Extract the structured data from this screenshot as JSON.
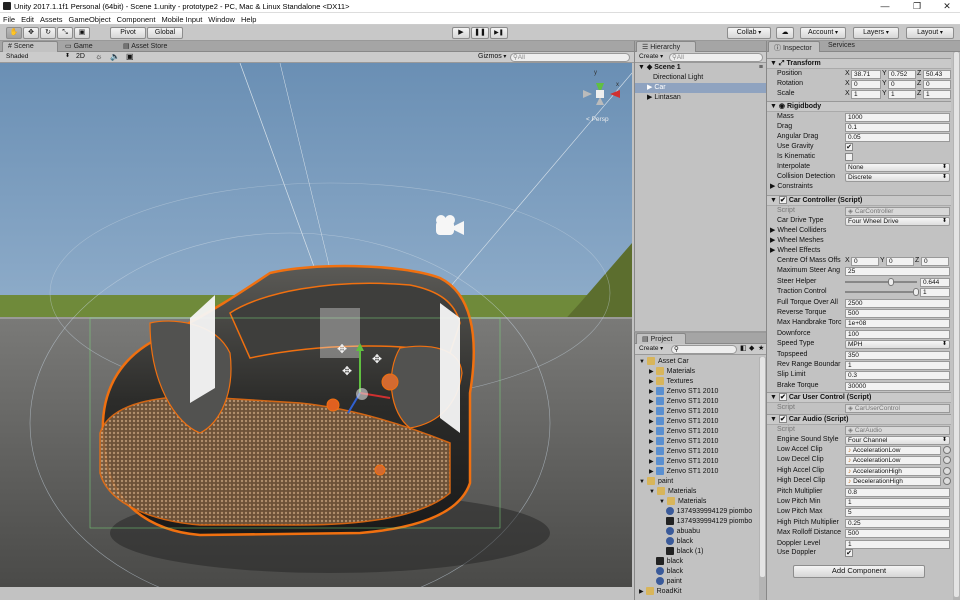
{
  "window": {
    "title": "Unity 2017.1.1f1 Personal (64bit) - Scene 1.unity - prototype2 - PC, Mac & Linux Standalone <DX11>",
    "min": "—",
    "max": "❐",
    "close": "✕"
  },
  "menu": [
    "File",
    "Edit",
    "Assets",
    "GameObject",
    "Component",
    "Mobile Input",
    "Window",
    "Help"
  ],
  "toolbar": {
    "pivot": "Pivot",
    "global": "Global",
    "collab": "Collab",
    "account": "Account",
    "layers": "Layers",
    "layout": "Layout",
    "play": "▶",
    "pause": "❚❚",
    "step": "▶❚"
  },
  "scene": {
    "tabs": [
      "Scene",
      "Game",
      "Asset Store"
    ],
    "shading": "Shaded",
    "mode2d": "2D",
    "gizmos": "Gizmos",
    "search": "All",
    "persp": "< Persp",
    "axes": {
      "y": "y",
      "x": "x"
    }
  },
  "hierarchy": {
    "tab": "Hierarchy",
    "create": "Create",
    "search": "All",
    "scene": "Scene 1",
    "items": [
      "Directional Light",
      "Car",
      "Lintasan"
    ]
  },
  "project": {
    "tab": "Project",
    "create": "Create",
    "items": [
      {
        "label": "Asset Car",
        "depth": 0,
        "icon": "folder"
      },
      {
        "label": "Materials",
        "depth": 1,
        "icon": "folder"
      },
      {
        "label": "Textures",
        "depth": 1,
        "icon": "folder"
      },
      {
        "label": "Zenvo ST1 2010",
        "depth": 1,
        "icon": "model"
      },
      {
        "label": "Zenvo ST1 2010",
        "depth": 1,
        "icon": "model"
      },
      {
        "label": "Zenvo ST1 2010",
        "depth": 1,
        "icon": "model"
      },
      {
        "label": "Zenvo ST1 2010",
        "depth": 1,
        "icon": "model"
      },
      {
        "label": "Zenvo ST1 2010",
        "depth": 1,
        "icon": "model"
      },
      {
        "label": "Zenvo ST1 2010",
        "depth": 1,
        "icon": "model"
      },
      {
        "label": "Zenvo ST1 2010",
        "depth": 1,
        "icon": "model"
      },
      {
        "label": "Zenvo ST1 2010",
        "depth": 1,
        "icon": "model"
      },
      {
        "label": "Zenvo ST1 2010",
        "depth": 1,
        "icon": "model"
      },
      {
        "label": "paint",
        "depth": 0,
        "icon": "folder"
      },
      {
        "label": "Materials",
        "depth": 1,
        "icon": "folder"
      },
      {
        "label": "Materials",
        "depth": 2,
        "icon": "folder"
      },
      {
        "label": "1374939994129 piombo",
        "depth": 2,
        "icon": "material"
      },
      {
        "label": "1374939994129 piombo",
        "depth": 2,
        "icon": "texture"
      },
      {
        "label": "abuabu",
        "depth": 2,
        "icon": "material"
      },
      {
        "label": "black",
        "depth": 2,
        "icon": "material"
      },
      {
        "label": "black (1)",
        "depth": 2,
        "icon": "texture"
      },
      {
        "label": "black",
        "depth": 1,
        "icon": "texture"
      },
      {
        "label": "black",
        "depth": 1,
        "icon": "material"
      },
      {
        "label": "paint",
        "depth": 1,
        "icon": "material"
      },
      {
        "label": "RoadKit",
        "depth": 0,
        "icon": "folder"
      }
    ]
  },
  "inspector": {
    "tabs": [
      "Inspector",
      "Services"
    ],
    "transform": {
      "title": "Transform",
      "position": {
        "label": "Position",
        "x": "38.71",
        "y": "0.752",
        "z": "50.43"
      },
      "rotation": {
        "label": "Rotation",
        "x": "0",
        "y": "0",
        "z": "0"
      },
      "scale": {
        "label": "Scale",
        "x": "1",
        "y": "1",
        "z": "1"
      }
    },
    "rigidbody": {
      "title": "Rigidbody",
      "mass": {
        "label": "Mass",
        "value": "1000"
      },
      "drag": {
        "label": "Drag",
        "value": "0.1"
      },
      "angular": {
        "label": "Angular Drag",
        "value": "0.05"
      },
      "gravity": {
        "label": "Use Gravity",
        "value": "✔"
      },
      "kinematic": {
        "label": "Is Kinematic",
        "value": ""
      },
      "interpolate": {
        "label": "Interpolate",
        "value": "None"
      },
      "collision": {
        "label": "Collision Detection",
        "value": "Discrete"
      },
      "constraints": "Constraints"
    },
    "carController": {
      "title": "Car Controller (Script)",
      "script": {
        "label": "Script",
        "value": "CarController"
      },
      "drive": {
        "label": "Car Drive Type",
        "value": "Four Wheel Drive"
      },
      "wheelColliders": "Wheel Colliders",
      "wheelMeshes": "Wheel Meshes",
      "wheelEffects": "Wheel Effects",
      "fields": [
        {
          "label": "Centre Of Mass Offs",
          "x": "0",
          "y": "0",
          "z": "0"
        },
        {
          "label": "Maximum Steer Ang",
          "value": "25"
        },
        {
          "label": "Steer Helper",
          "value": "0.644",
          "slider": 0.644
        },
        {
          "label": "Traction Control",
          "value": "1",
          "slider": 1
        },
        {
          "label": "Full Torque Over All",
          "value": "2500"
        },
        {
          "label": "Reverse Torque",
          "value": "500"
        },
        {
          "label": "Max Handbrake Torc",
          "value": "1e+08"
        },
        {
          "label": "Downforce",
          "value": "100"
        },
        {
          "label": "Speed Type",
          "value": "MPH",
          "drop": true
        },
        {
          "label": "Topspeed",
          "value": "350"
        },
        {
          "label": "Rev Range Boundar",
          "value": "1"
        },
        {
          "label": "Slip Limit",
          "value": "0.3"
        },
        {
          "label": "Brake Torque",
          "value": "30000"
        }
      ]
    },
    "carUser": {
      "title": "Car User Control (Script)",
      "script": {
        "label": "Script",
        "value": "CarUserControl"
      }
    },
    "carAudio": {
      "title": "Car Audio (Script)",
      "script": {
        "label": "Script",
        "value": "CarAudio"
      },
      "style": {
        "label": "Engine Sound Style",
        "value": "Four Channel"
      },
      "clips": [
        {
          "label": "Low Accel Clip",
          "value": "AccelerationLow"
        },
        {
          "label": "Low Decel Clip",
          "value": "AccelerationLow"
        },
        {
          "label": "High Accel Clip",
          "value": "AccelerationHigh"
        },
        {
          "label": "High Decel Clip",
          "value": "DecelerationHigh"
        }
      ],
      "fields": [
        {
          "label": "Pitch Multiplier",
          "value": "0.8"
        },
        {
          "label": "Low Pitch Min",
          "value": "1"
        },
        {
          "label": "Low Pitch Max",
          "value": "5"
        },
        {
          "label": "High Pitch Multiplier",
          "value": "0.25"
        },
        {
          "label": "Max Rolloff Distance",
          "value": "500"
        },
        {
          "label": "Doppler Level",
          "value": "1"
        }
      ],
      "doppler": {
        "label": "Use Doppler",
        "value": "✔"
      }
    },
    "addComponent": "Add Component"
  }
}
